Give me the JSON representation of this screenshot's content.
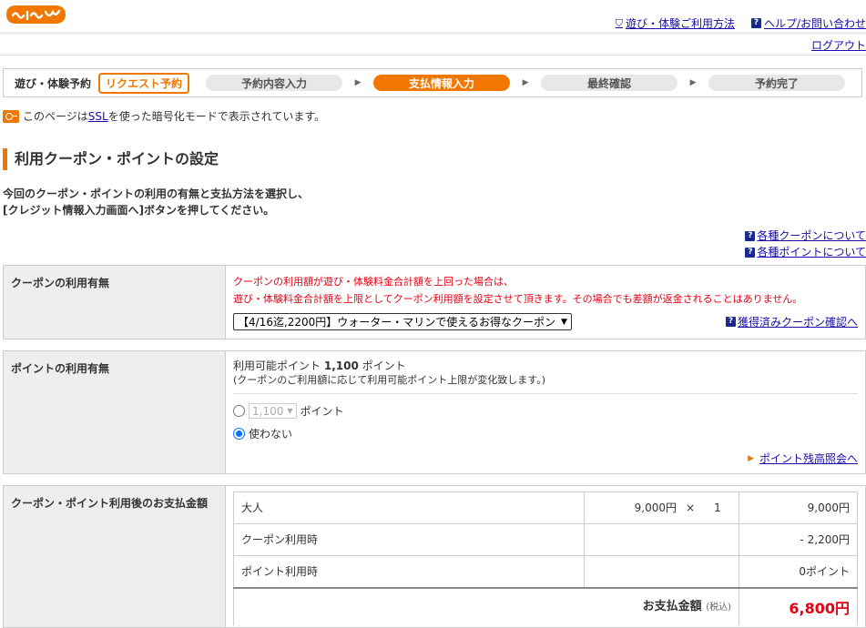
{
  "header": {
    "logo_alt": "じゃらん",
    "links": [
      "遊び・体験ご利用方法",
      "ヘルプ/お問い合わせ"
    ],
    "logout": "ログアウト"
  },
  "steps": {
    "label": "遊び・体験予約",
    "badge": "リクエスト予約",
    "items": [
      "予約内容入力",
      "支払情報入力",
      "最終確認",
      "予約完了"
    ],
    "active_index": 1
  },
  "ssl": {
    "prefix": "このページは",
    "link": "SSL",
    "suffix": "を使った暗号化モードで表示されています。"
  },
  "section_title": "利用クーポン・ポイントの設定",
  "intro": {
    "line1": "今回のクーポン・ポイントの利用の有無と支払方法を選択し、",
    "line2": "[クレジット情報入力画面へ]ボタンを押してください。"
  },
  "help_links": [
    "各種クーポンについて",
    "各種ポイントについて"
  ],
  "coupon": {
    "label": "クーポンの利用有無",
    "note1": "クーポンの利用額が遊び・体験料金合計額を上回った場合は、",
    "note2": "遊び・体験料金合計額を上限としてクーポン利用額を設定させて頂きます。その場合でも差額が返金されることはありません。",
    "selected": "【4/16迄,2200円】ウォーター・マリンで使えるお得なクーポン",
    "link": "獲得済みクーポン確認へ"
  },
  "points": {
    "label": "ポイントの利用有無",
    "available_prefix": "利用可能ポイント",
    "available_value": "1,100",
    "available_suffix": "ポイント",
    "note": "(クーポンのご利用額に応じて利用可能ポイント上限が変化致します。)",
    "option_use_value": "1,100",
    "option_use_unit": "ポイント",
    "option_none": "使わない",
    "balance_link": "ポイント残高照会へ"
  },
  "payment": {
    "label": "クーポン・ポイント利用後のお支払金額",
    "rows": [
      {
        "name": "大人",
        "unit_price": "9,000円",
        "times": "×",
        "qty": "1",
        "amount": "9,000円"
      },
      {
        "name": "クーポン利用時",
        "amount": "- 2,200円"
      },
      {
        "name": "ポイント利用時",
        "amount": "0ポイント"
      }
    ],
    "total_label": "お支払金額",
    "total_note": "(税込)",
    "total_value": "6,800円"
  },
  "colors": {
    "accent": "#f07800",
    "alert": "#e60012",
    "link": "#1a0dab"
  }
}
